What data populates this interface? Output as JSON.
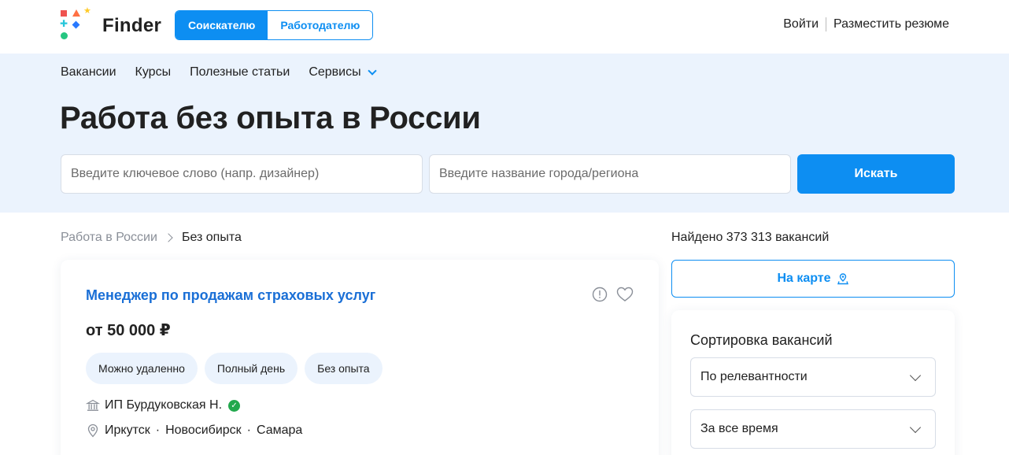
{
  "header": {
    "logo_text": "Finder",
    "role_tabs": [
      "Соискателю",
      "Работодателю"
    ],
    "login_label": "Войти",
    "post_resume_label": "Разместить резюме"
  },
  "nav": {
    "items": [
      "Вакансии",
      "Курсы",
      "Полезные статьи",
      "Сервисы"
    ]
  },
  "page_title": "Работа без опыта в России",
  "search": {
    "keyword_placeholder": "Введите ключевое слово (напр. дизайнер)",
    "city_placeholder": "Введите название города/региона",
    "button_label": "Искать"
  },
  "breadcrumb": {
    "parent": "Работа в России",
    "current": "Без опыта"
  },
  "vacancy": {
    "title": "Менеджер по продажам страховых услуг",
    "salary": "от 50 000 ₽",
    "tags": [
      "Можно удаленно",
      "Полный день",
      "Без опыта"
    ],
    "employer": "ИП Бурдуковская Н.",
    "cities": [
      "Иркутск",
      "Новосибирск",
      "Самара"
    ]
  },
  "results": {
    "found_text": "Найдено 373 313 вакансий",
    "map_button_label": "На карте"
  },
  "sort": {
    "title": "Сортировка вакансий",
    "order_value": "По релевантности",
    "period_value": "За все время"
  },
  "colors": {
    "accent": "#0d8ef2",
    "link": "#1a6fd6",
    "hero_bg": "#ebf3fd",
    "verified": "#22a84d"
  }
}
